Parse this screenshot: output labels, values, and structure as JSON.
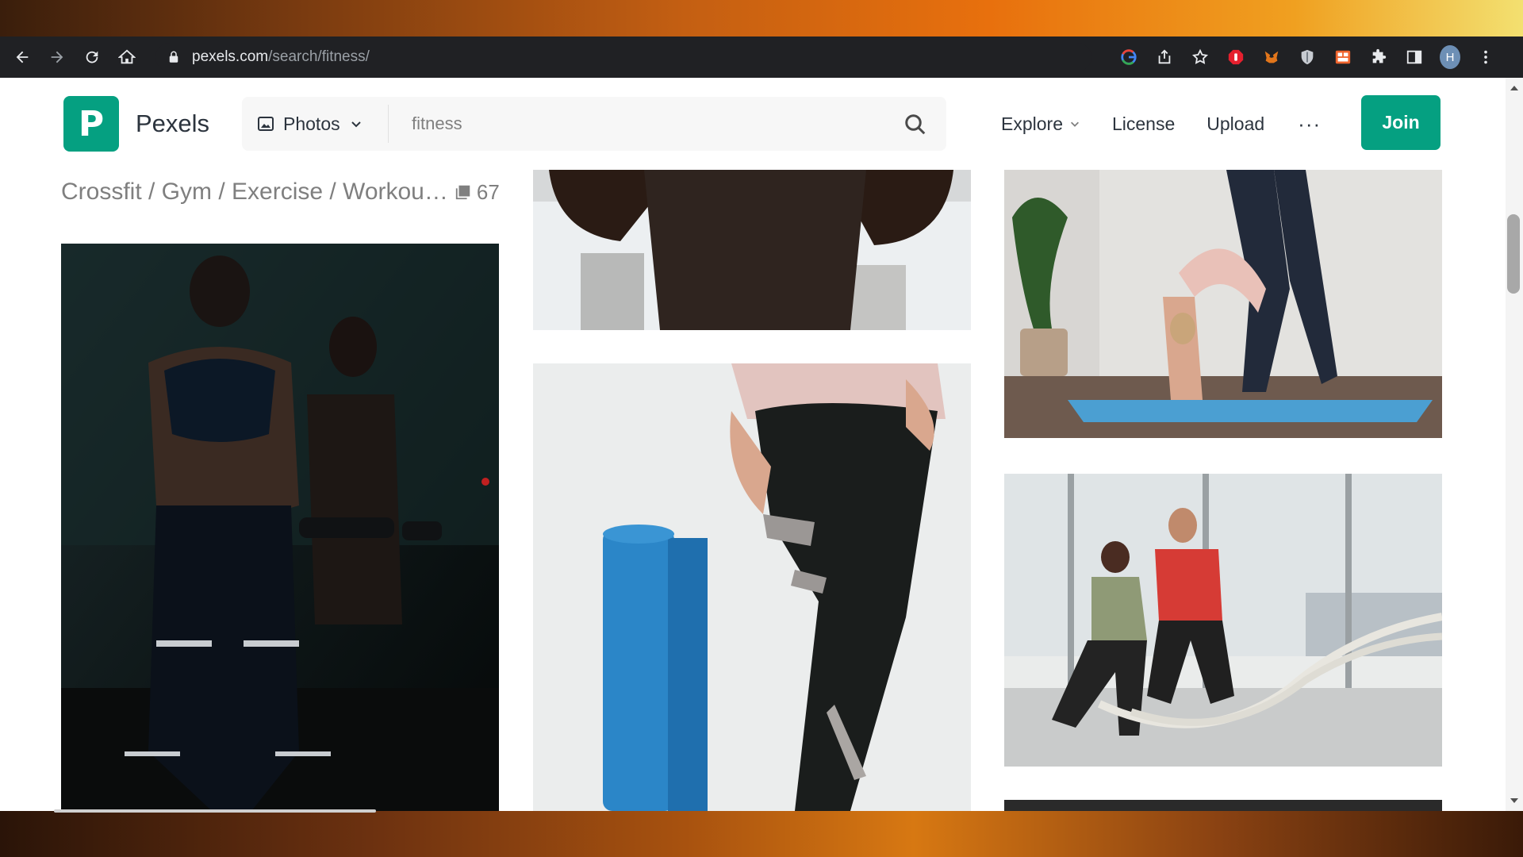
{
  "browser": {
    "url_host": "pexels.com",
    "url_path": "/search/fitness/",
    "profile_initial": "H",
    "icons": [
      "back-icon",
      "forward-icon",
      "reload-icon",
      "home-icon",
      "lock-icon",
      "google-icon",
      "share-icon",
      "star-icon",
      "adblock-icon",
      "metamask-icon",
      "shield-icon",
      "extension-grid-icon",
      "puzzle-icon",
      "sidepanel-icon",
      "menu-icon"
    ]
  },
  "header": {
    "brand": "Pexels",
    "logo_letter": "P",
    "search_type": "Photos",
    "search_value": "fitness",
    "nav": {
      "explore": "Explore",
      "license": "License",
      "upload": "Upload",
      "more": "···"
    },
    "join": "Join"
  },
  "collection": {
    "title": "Crossfit / Gym / Exercise / Workou…",
    "count": "67"
  },
  "photos": [
    {
      "id": "woman-dumbbells-mirror",
      "column": 1
    },
    {
      "id": "woman-black-top-window",
      "column": 2
    },
    {
      "id": "yoga-mat-leggings",
      "column": 2
    },
    {
      "id": "yoga-backbend-mat",
      "column": 3
    },
    {
      "id": "battle-ropes-trainer",
      "column": 3
    },
    {
      "id": "partial-dark-photo",
      "column": 3
    }
  ],
  "colors": {
    "brand": "#05a081",
    "text": "#2c343e",
    "muted": "#7f7f7f",
    "chrome_bg": "#202124"
  }
}
